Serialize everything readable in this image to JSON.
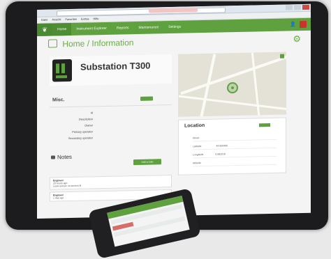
{
  "colors": {
    "brand_green": "#5fa13f",
    "danger_red": "#c8332c",
    "bezel": "#1c1c1e"
  },
  "menubar": {
    "items": [
      "Datei",
      "Ansicht",
      "Favoriten",
      "Extras",
      "Hilfe"
    ]
  },
  "navbar": {
    "logo_icon": "leaf-icon",
    "items": [
      "Home",
      "Instrument Explorer",
      "Reports",
      "Maintenance",
      "Settings"
    ],
    "user_icon": "user-icon",
    "logout_icon": "power-icon"
  },
  "breadcrumb": {
    "home": "Home",
    "separator": "/",
    "current": "Information"
  },
  "device": {
    "title": "Substation T300",
    "icon": "rtu-device-icon"
  },
  "misc": {
    "label": "Misc.",
    "fields": [
      "Id",
      "Description",
      "Owner",
      "Primary operator",
      "Secondary operator"
    ]
  },
  "notes": {
    "title": "Notes",
    "add_label": "Add a note",
    "entries": [
      {
        "author": "Engineer",
        "time": "20 hours ago",
        "text": "Level sensor on section B"
      },
      {
        "author": "Engineer",
        "time": "1 day ago",
        "text": ""
      }
    ]
  },
  "location": {
    "title": "Location",
    "rows": [
      {
        "label": "Street",
        "value": ""
      },
      {
        "label": "Latitude",
        "value": "44.826400"
      },
      {
        "label": "Longitude",
        "value": "0.582015"
      },
      {
        "label": "Altitude",
        "value": ""
      }
    ]
  }
}
